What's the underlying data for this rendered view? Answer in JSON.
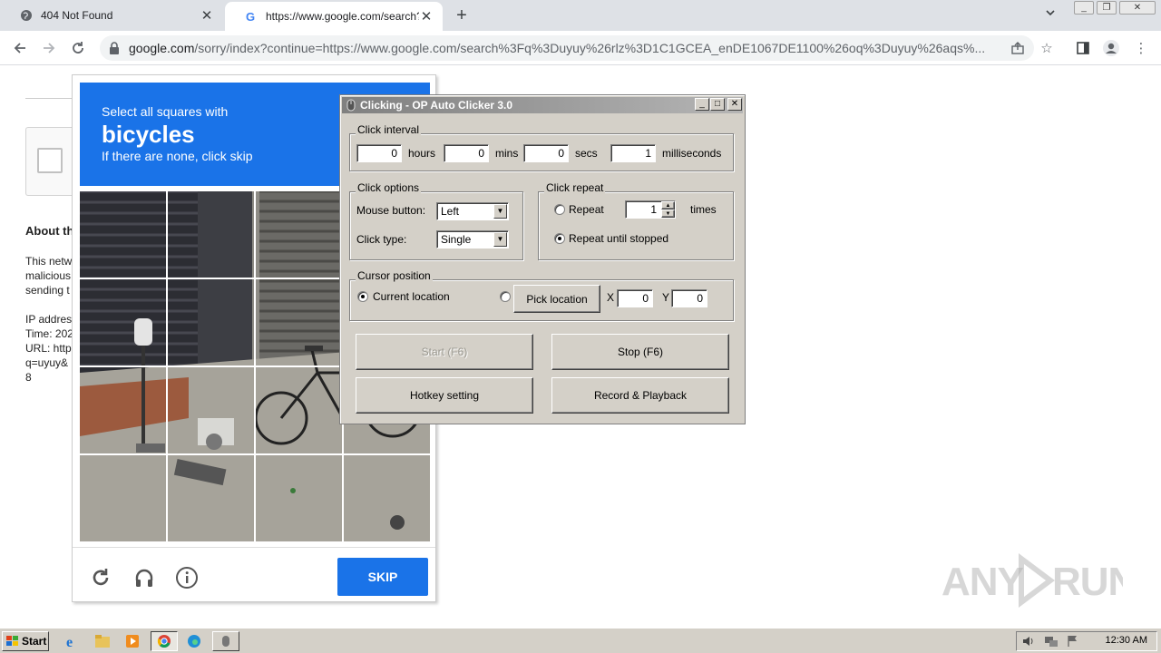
{
  "browser": {
    "tabs": [
      {
        "title": "404 Not Found"
      },
      {
        "title": "https://www.google.com/search?q="
      }
    ],
    "url_host": "google.com",
    "url_rest": "/sorry/index?continue=https://www.google.com/search%3Fq%3Duyuy%26rlz%3D1C1GCEA_enDE1067DE1100%26oq%3Duyuy%26aqs%..."
  },
  "page": {
    "about": "About th",
    "para1": [
      "This netw",
      "malicious",
      "sending t"
    ],
    "para2": [
      "IP addres",
      "Time: 202",
      "URL: http",
      "q=uyuy&",
      "8"
    ]
  },
  "captcha": {
    "instruction": "Select all squares with",
    "target": "bicycles",
    "hint": "If there are none, click skip",
    "skip_label": "SKIP"
  },
  "clicker": {
    "title": "Clicking - OP Auto Clicker 3.0",
    "interval": {
      "label": "Click interval",
      "hours": "0",
      "hours_label": "hours",
      "mins": "0",
      "mins_label": "mins",
      "secs": "0",
      "secs_label": "secs",
      "ms": "1",
      "ms_label": "milliseconds"
    },
    "options": {
      "label": "Click options",
      "mouse_label": "Mouse button:",
      "mouse_value": "Left",
      "type_label": "Click type:",
      "type_value": "Single"
    },
    "repeat": {
      "label": "Click repeat",
      "repeat_label": "Repeat",
      "repeat_value": "1",
      "times_label": "times",
      "until_label": "Repeat until stopped"
    },
    "cursor": {
      "label": "Cursor position",
      "current_label": "Current location",
      "pick_label": "Pick location",
      "x_label": "X",
      "x_value": "0",
      "y_label": "Y",
      "y_value": "0"
    },
    "buttons": {
      "start": "Start (F6)",
      "stop": "Stop (F6)",
      "hotkey": "Hotkey setting",
      "record": "Record & Playback"
    }
  },
  "taskbar": {
    "start_label": "Start",
    "clock": "12:30 AM"
  },
  "watermark": "ANY RUN"
}
